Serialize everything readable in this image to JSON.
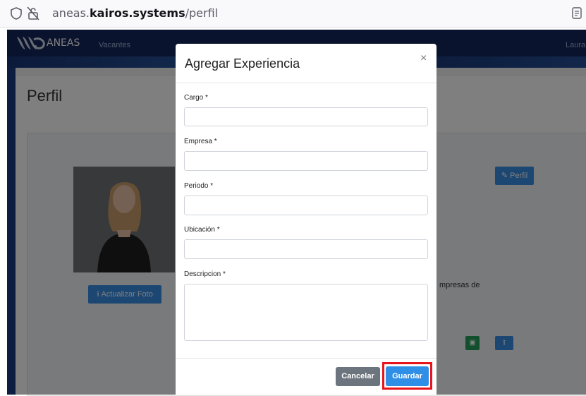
{
  "browser": {
    "url_prefix": "aneas.",
    "url_domain": "kairos.systems",
    "url_path": "/perfil"
  },
  "navbar": {
    "brand": "ANEAS",
    "link_vacantes": "Vacantes",
    "user": "Laura"
  },
  "page": {
    "title": "Perfil",
    "btn_actualizar_foto": "Actualizar Foto",
    "btn_perfil": "Perfil",
    "bio_fragment": "mpresas de"
  },
  "modal": {
    "title": "Agregar Experiencia",
    "close": "×",
    "fields": {
      "cargo": {
        "label": "Cargo *",
        "value": ""
      },
      "empresa": {
        "label": "Empresa *",
        "value": ""
      },
      "periodo": {
        "label": "Periodo *",
        "value": ""
      },
      "ubicacion": {
        "label": "Ubicación *",
        "value": ""
      },
      "descripcion": {
        "label": "Descripcion *",
        "value": ""
      }
    },
    "btn_cancel": "Cancelar",
    "btn_save": "Guardar"
  },
  "colors": {
    "primary": "#2f8fe6",
    "secondary": "#6c757d",
    "highlight": "#e8131b",
    "navbar": "#14265a",
    "success": "#25a15a"
  }
}
